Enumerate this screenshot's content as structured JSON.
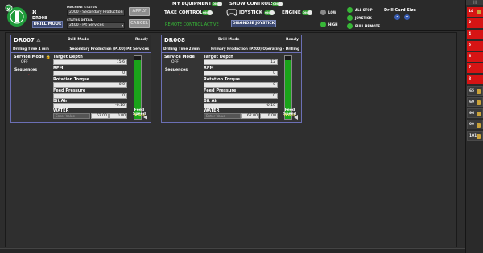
{
  "header": {
    "machine_number": "8",
    "machine_id": "DR008",
    "mode_button": "DRILL MODE",
    "machine_status_label": "MACHINE STATUS",
    "machine_status_value": "2000 - Secondary Production (P1",
    "status_detail_label": "STATUS DETAIL",
    "status_detail_value": "2400 - Pit Services",
    "btn_upper": "APPLY",
    "btn_lower": "CANCEL",
    "my_equipment_label": "MY EQUIPMENT",
    "show_controls_label": "SHOW CONTROLS",
    "take_control_label": "TAKE CONTROL",
    "joystick_label": "JOYSTICK",
    "engine_label": "ENGINE",
    "toggle_text": "ON",
    "remote_control_text": "REMOTE CONTROL ACTIVE",
    "diagnose_button": "DIAGNOSE JOYSTICK",
    "low_label": "LOW",
    "high_label": "HIGH",
    "all_stop_label": "ALL STOP",
    "joystick_status_label": "JOYSTICK",
    "full_remote_label": "FULL REMOTE",
    "drill_card_size_label": "Drill Card Size",
    "size_down": "-",
    "size_up": "+",
    "colors": {
      "accent_blue": "#3d4a72",
      "on_green": "#2f9b2f",
      "led_green": "#37b637",
      "alert_red": "#d61414"
    }
  },
  "cards": [
    {
      "id": "DR007",
      "warning_icon": "warning-icon",
      "mode": "Drill Mode",
      "state": "Ready",
      "drilling_time": "Drilling Time 4 min",
      "production": "Secondary Production (P100) Pit Services",
      "service_mode_label": "Service Mode",
      "service_mode_value": "OFF",
      "sequences_label": "Sequences",
      "sequences_value": "-",
      "target_depth_label": "Target Depth",
      "target_depth": "15.6",
      "rpm_label": "RPM",
      "rpm": "0",
      "rotation_torque_label": "Rotation Torque",
      "rotation_torque": "0.0",
      "feed_pressure_label": "Feed Pressure",
      "feed_pressure": "0",
      "bit_air_label": "Bit Air",
      "bit_air": "-0.10",
      "water_label": "WATER",
      "enter_value": "Enter Value",
      "water_a": "62.00",
      "water_b": "0.00",
      "feed_speed_label": "Feed Speed",
      "feed_speed": "0 m/s",
      "feed_level": 0.93
    },
    {
      "id": "DR008",
      "mode": "Drill Mode",
      "state": "Ready",
      "drilling_time": "Drilling Time 2 min",
      "production": "Primary Production (P200) Operating - Drilling",
      "service_mode_label": "Service Mode",
      "service_mode_value": "OFF",
      "sequences_label": "Sequences",
      "sequences_value": "•",
      "target_depth_label": "Target Depth",
      "target_depth": "12",
      "rpm_label": "RPM",
      "rpm": "0",
      "rotation_torque_label": "Rotation Torque",
      "rotation_torque": "0",
      "feed_pressure_label": "Feed Pressure",
      "feed_pressure": "0",
      "bit_air_label": "Bit Air",
      "bit_air": "-0.10",
      "water_label": "WATER",
      "enter_value": "Enter Value",
      "water_a": "62.00",
      "water_b": "0.00",
      "feed_speed_label": "Feed Speed",
      "feed_speed": "0 m/s",
      "feed_level": 0.93
    }
  ],
  "right_panel": {
    "top_label": "|||",
    "items": [
      {
        "label": "14",
        "style": "red",
        "icon": "equipment-icon"
      },
      {
        "label": "2",
        "style": "red",
        "icon": ""
      },
      {
        "label": "4",
        "style": "red",
        "icon": ""
      },
      {
        "label": "5",
        "style": "red",
        "icon": ""
      },
      {
        "label": "6",
        "style": "red",
        "icon": ""
      },
      {
        "label": "7",
        "style": "red",
        "icon": ""
      },
      {
        "label": "8",
        "style": "red",
        "icon": ""
      },
      {
        "label": "65",
        "style": "dark",
        "icon": "equipment-icon"
      },
      {
        "label": "69",
        "style": "dark",
        "icon": "equipment-icon"
      },
      {
        "label": "96",
        "style": "dark",
        "icon": "equipment-icon"
      },
      {
        "label": "99",
        "style": "dark",
        "icon": "equipment-icon"
      },
      {
        "label": "101",
        "style": "dark",
        "icon": "equipment-icon"
      }
    ]
  }
}
